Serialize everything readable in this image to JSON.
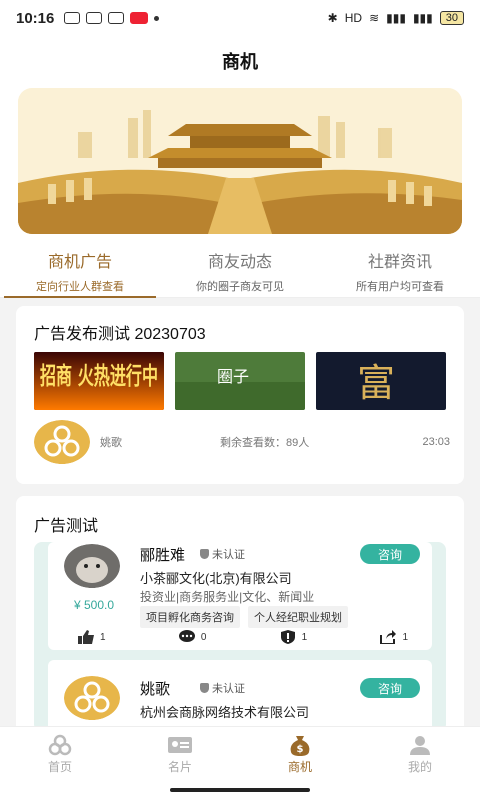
{
  "status": {
    "time": "10:16",
    "battery": "30"
  },
  "header": {
    "title": "商机"
  },
  "tabs": [
    {
      "label": "商机广告",
      "sub": "定向行业人群查看",
      "active": true
    },
    {
      "label": "商友动态",
      "sub": "你的圈子商友可见",
      "active": false
    },
    {
      "label": "社群资讯",
      "sub": "所有用户均可查看",
      "active": false
    }
  ],
  "ad_post": {
    "title": "广告发布测试 20230703",
    "images": [
      "招商 火热进行中",
      "圈子",
      "富"
    ],
    "author": "姚歌",
    "remaining": "剩余查看数：89人",
    "time": "23:03"
  },
  "ad_test": {
    "title": "广告测试",
    "items": [
      {
        "name": "郦胜难",
        "verified": "未认证",
        "consult": "咨询",
        "company": "小茶郦文化(北京)有限公司",
        "industry": "投资业|商务服务业|文化、新闻业",
        "price": "¥ 500.0",
        "tags": [
          "项目孵化商务咨询",
          "个人经纪职业规划"
        ],
        "likes": "1",
        "comments": "0",
        "reports": "1",
        "shares": "1"
      },
      {
        "name": "姚歌",
        "verified": "未认证",
        "consult": "咨询",
        "company": "杭州会商脉网络技术有限公司"
      }
    ]
  },
  "nav": [
    {
      "label": "首页",
      "icon": "home-icon",
      "active": false
    },
    {
      "label": "名片",
      "icon": "card-icon",
      "active": false
    },
    {
      "label": "商机",
      "icon": "money-bag-icon",
      "active": true
    },
    {
      "label": "我的",
      "icon": "user-icon",
      "active": false
    }
  ],
  "colors": {
    "accent": "#9a6a2a",
    "teal": "#34b3a0"
  }
}
